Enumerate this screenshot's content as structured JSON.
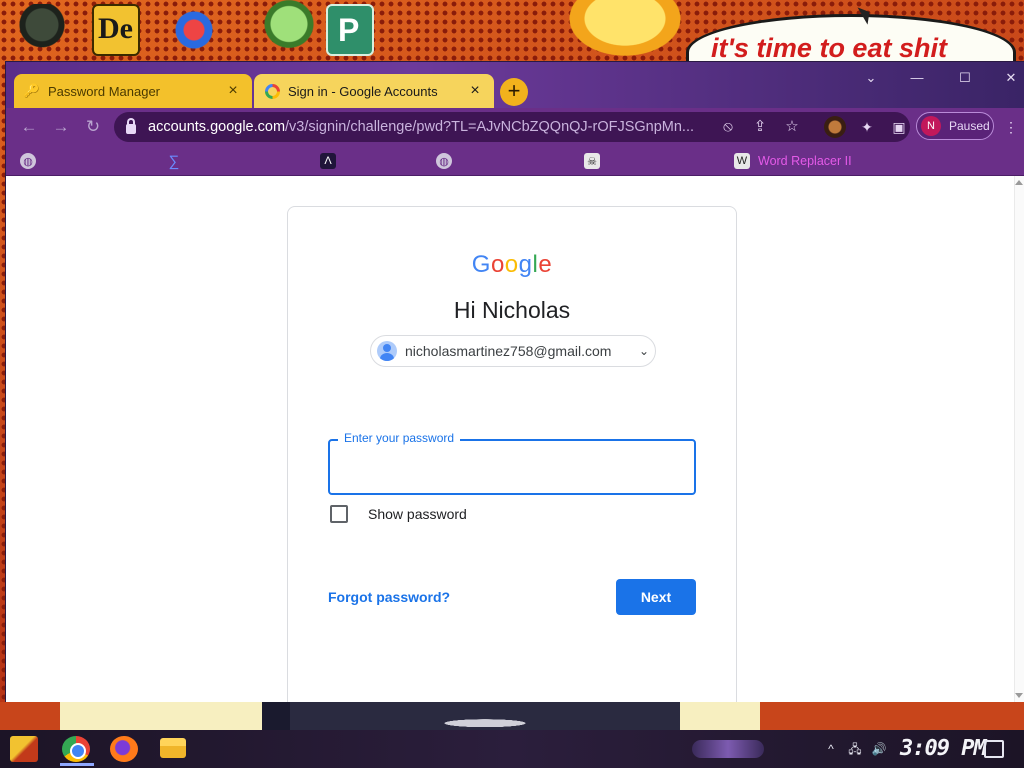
{
  "desktop": {
    "icons": [
      {
        "name": "helmet-app-icon"
      },
      {
        "name": "de-app-icon",
        "text": "De"
      },
      {
        "name": "number-2-app-icon"
      },
      {
        "name": "character-app-icon"
      },
      {
        "name": "publisher-app-icon",
        "text": "P"
      }
    ],
    "speech_bubble_text": "it's time to eat shit"
  },
  "browser": {
    "tabs": [
      {
        "label": "Password Manager",
        "icon": "key-icon",
        "close": "×"
      },
      {
        "label": "Sign in - Google Accounts",
        "icon": "google-icon",
        "close": "×",
        "active": true
      }
    ],
    "new_tab_label": "+",
    "window_controls": {
      "tab_search": "⌄",
      "minimize": "—",
      "maximize": "☐",
      "close": "✕"
    },
    "nav": {
      "back": "←",
      "forward": "→",
      "reload": "↻"
    },
    "url": {
      "host": "accounts.google.com",
      "path": "/v3/signin/challenge/pwd?TL=AJvNCbZQQnQJ-rOFJSGnpMn..."
    },
    "omnibox_icons": {
      "eye_off": "⦸",
      "share": "⇪",
      "star": "☆"
    },
    "toolbar_icons": {
      "extensions": "✦",
      "side_panel": "▣",
      "menu": "⋮"
    },
    "profile": {
      "initial": "N",
      "status": "Paused"
    },
    "bookmarks": [
      {
        "label": "",
        "icon": "globe-icon",
        "glyph": "◍"
      },
      {
        "label": "",
        "icon": "sigma-icon",
        "glyph": "∑"
      },
      {
        "label": "",
        "icon": "lambda-icon",
        "glyph": "Λ"
      },
      {
        "label": "",
        "icon": "globe-icon",
        "glyph": "◍"
      },
      {
        "label": "",
        "icon": "skull-icon",
        "glyph": "☠"
      },
      {
        "label": "Word Replacer II",
        "icon": "word-replacer-icon",
        "glyph": "W"
      }
    ]
  },
  "signin": {
    "logo": [
      "G",
      "o",
      "o",
      "g",
      "l",
      "e"
    ],
    "logo_colors": [
      "#4285f4",
      "#ea4335",
      "#fbbc05",
      "#4285f4",
      "#34a853",
      "#ea4335"
    ],
    "greeting": "Hi Nicholas",
    "email": "nicholasmartinez758@gmail.com",
    "email_chevron": "⌄",
    "password_label": "Enter your password",
    "password_value": "",
    "show_password_label": "Show password",
    "show_password_checked": false,
    "forgot_label": "Forgot password?",
    "next_label": "Next"
  },
  "taskbar": {
    "apps": [
      "chrome-icon",
      "firefox-icon",
      "file-explorer-icon"
    ],
    "tray": {
      "overflow": "^",
      "network": "🖧",
      "volume": "🔊"
    },
    "time": "3:09 PM"
  },
  "colors": {
    "accent_blue": "#1a73e8",
    "browser_frame": "#6a2f88",
    "active_tab": "#f6d45c"
  }
}
